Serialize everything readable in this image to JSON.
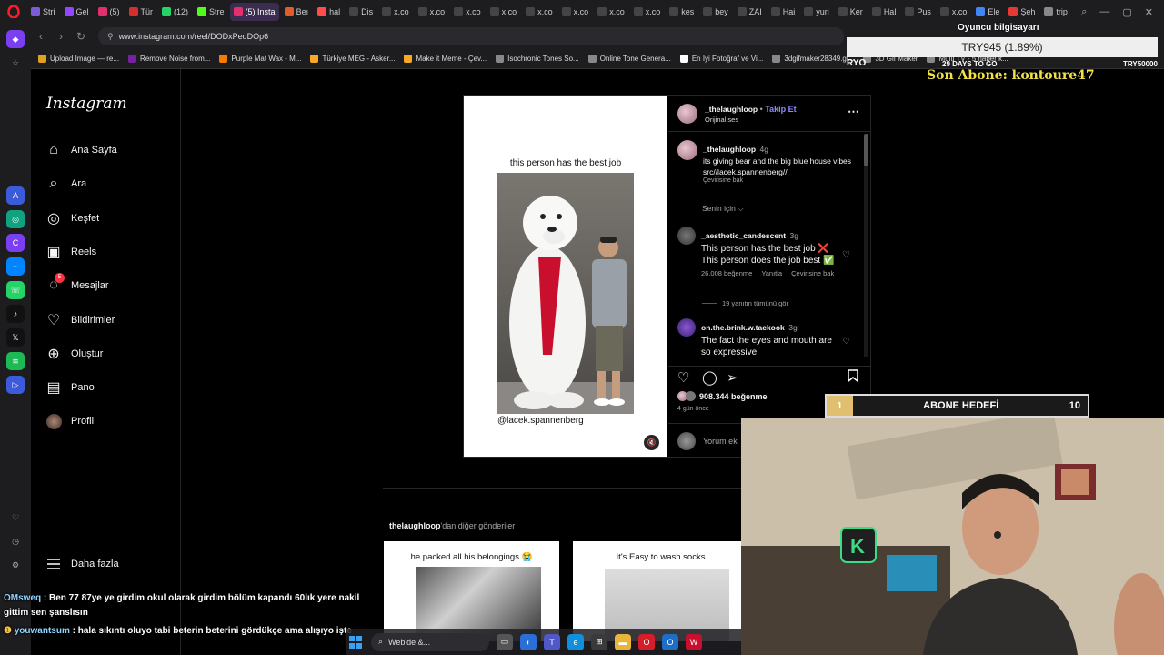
{
  "browser": {
    "tabs": [
      {
        "label": "Stri",
        "color": "#7b5cd6"
      },
      {
        "label": "Gel",
        "color": "#9146ff"
      },
      {
        "label": "(5)",
        "color": "#e1306c"
      },
      {
        "label": "Tür",
        "color": "#d32f2f"
      },
      {
        "label": "(12)",
        "color": "#25d366"
      },
      {
        "label": "Stre",
        "color": "#53fc18"
      },
      {
        "label": "(5) Insta",
        "color": "#e1306c",
        "active": true
      },
      {
        "label": "Beı",
        "color": "#e25b2a"
      },
      {
        "label": "hal",
        "color": "#ff4d4d"
      },
      {
        "label": "Dis",
        "color": "#444"
      },
      {
        "label": "x.co",
        "color": "#444"
      },
      {
        "label": "x.co",
        "color": "#444"
      },
      {
        "label": "x.co",
        "color": "#444"
      },
      {
        "label": "x.co",
        "color": "#444"
      },
      {
        "label": "x.co",
        "color": "#444"
      },
      {
        "label": "x.co",
        "color": "#444"
      },
      {
        "label": "x.co",
        "color": "#444"
      },
      {
        "label": "x.co",
        "color": "#444"
      },
      {
        "label": "kes",
        "color": "#444"
      },
      {
        "label": "bey",
        "color": "#444"
      },
      {
        "label": "ZAI",
        "color": "#444"
      },
      {
        "label": "Hai",
        "color": "#444"
      },
      {
        "label": "yuri",
        "color": "#444"
      },
      {
        "label": "Ker",
        "color": "#444"
      },
      {
        "label": "Hal",
        "color": "#444"
      },
      {
        "label": "Pus",
        "color": "#444"
      },
      {
        "label": "x.co",
        "color": "#444"
      },
      {
        "label": "Ele",
        "color": "#4285f4"
      },
      {
        "label": "Şeh",
        "color": "#e53935"
      },
      {
        "label": "trip",
        "color": "#888"
      }
    ],
    "url": "www.instagram.com/reel/DODxPeuDOp6",
    "bookmarks": [
      {
        "label": "Upload Image — re...",
        "color": "#e0a020"
      },
      {
        "label": "Remove Noise from...",
        "color": "#7b1fa2"
      },
      {
        "label": "Purple Mat Wax - M...",
        "color": "#f57c00"
      },
      {
        "label": "Türkiye MEG - Asker...",
        "color": "#f9a825"
      },
      {
        "label": "Make it Meme - Çev...",
        "color": "#f9a825"
      },
      {
        "label": "Isochronic Tones So...",
        "color": "#888"
      },
      {
        "label": "Online Tone Genera...",
        "color": "#888"
      },
      {
        "label": "En İyi Fotoğraf ve Vi...",
        "color": "#fff"
      },
      {
        "label": "3dgifmaker28349.gi...",
        "color": "#888"
      },
      {
        "label": "3D Gif Maker",
        "color": "#888"
      },
      {
        "label": "Multi TV - 5 haber k...",
        "color": "#888"
      }
    ]
  },
  "instagram": {
    "logo": "Instagram",
    "nav": [
      {
        "label": "Ana Sayfa",
        "icon": "home-icon",
        "glyph": "⌂"
      },
      {
        "label": "Ara",
        "icon": "search-icon",
        "glyph": "⌕"
      },
      {
        "label": "Keşfet",
        "icon": "explore-icon",
        "glyph": "◎"
      },
      {
        "label": "Reels",
        "icon": "reels-icon",
        "glyph": "▣"
      },
      {
        "label": "Mesajlar",
        "icon": "messages-icon",
        "glyph": "◌",
        "badge": "5"
      },
      {
        "label": "Bildirimler",
        "icon": "heart-icon",
        "glyph": "♡"
      },
      {
        "label": "Oluştur",
        "icon": "create-icon",
        "glyph": "⊕"
      },
      {
        "label": "Pano",
        "icon": "dashboard-icon",
        "glyph": "▤"
      },
      {
        "label": "Profil",
        "icon": "profile-avatar",
        "glyph": ""
      }
    ],
    "more_label": "Daha fazla",
    "post": {
      "video_caption": "this person has the best job",
      "video_credit": "@lacek.spannenberg",
      "author": "_thelaughloop",
      "follow_label": "Takip Et",
      "audio": "Orijinal ses",
      "caption_author": "_thelaughloop",
      "caption_time": "4g",
      "caption_text": "its giving bear and the big blue house vibes",
      "caption_src": "src//lacek.spannenberg//",
      "caption_translate": "Çevirisine bak",
      "for_you": "Senin için",
      "comments": [
        {
          "author": "_aesthetic_candescent",
          "time": "3g",
          "text": "This person has the best job ❌ This person does the job best ✅",
          "likes": "26.008 beğenme",
          "reply": "Yanıtla",
          "translate": "Çevirisine bak",
          "replies": "19 yanıtın tümünü gör"
        },
        {
          "author": "on.the.brink.w.taekook",
          "time": "3g",
          "text": "The fact the eyes and mouth are so expressive."
        }
      ],
      "like_count": "908.344 beğenme",
      "posted": "4 gün önce",
      "comment_placeholder": "Yorum ek"
    },
    "more_from": "_thelaughloop",
    "more_from_suffix": "'dan diğer gönderiler",
    "thumbs": [
      {
        "caption": "he packed all his belongings 😭"
      },
      {
        "caption": "It's Easy to wash socks"
      }
    ]
  },
  "stream": {
    "pc_label": "Oyuncu bilgisayarı",
    "try_value": "TRY945 (1.89%)",
    "left_label": "RYO",
    "days_to_go": "29 DAYS TO GO",
    "right_label": "TRY50000",
    "last_sub": "Son Abone: kontoure47",
    "goal_current": "1",
    "goal_label": "ABONE HEDEFİ",
    "goal_target": "10",
    "goal_progress": 0.1,
    "chat": [
      {
        "user": "OMsweq",
        "text": "Ben 77 87ye ye girdim okul olarak girdim bölüm kapandı 60lık yere nakil gittim sen şanslısın"
      },
      {
        "user": "youwantsum",
        "text": "hala sıkıntı oluyo tabi beterin beterini gördükçe ama alışıyo işte"
      }
    ],
    "taskbar_search": "Web'de &..."
  }
}
